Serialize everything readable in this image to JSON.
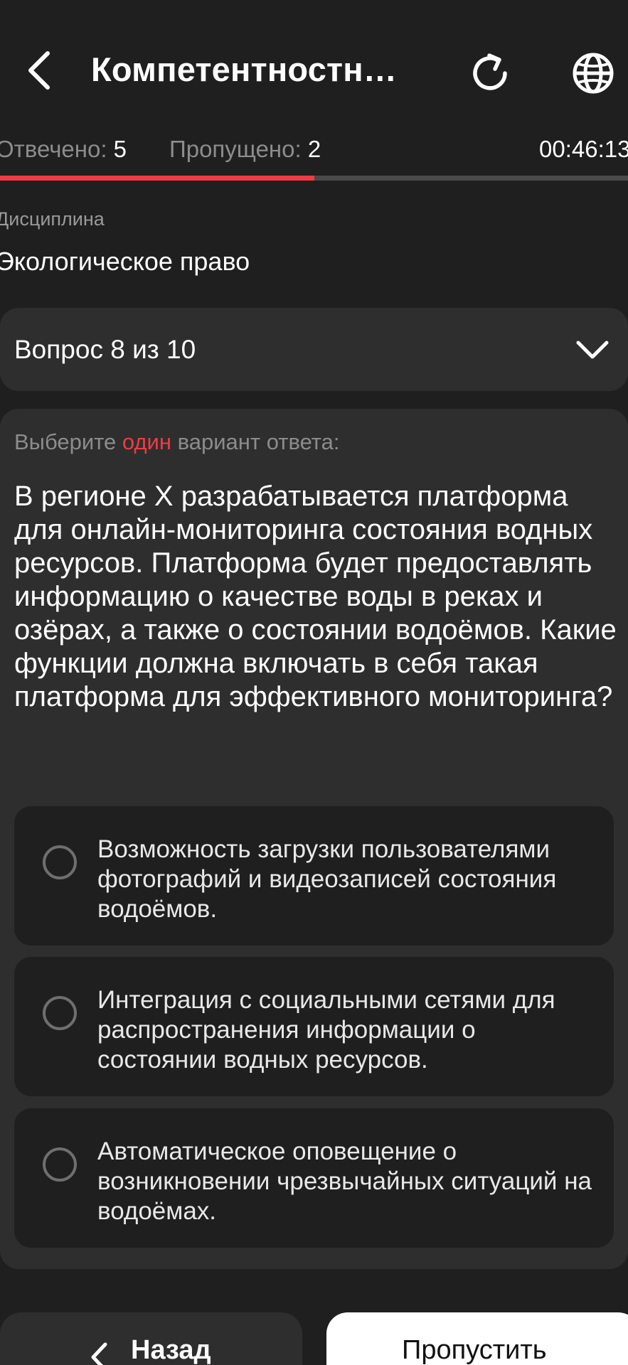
{
  "header": {
    "title": "Компетентностны…"
  },
  "stats": {
    "answered_label": "Отвечено:",
    "answered_value": "5",
    "skipped_label": "Пропущено:",
    "skipped_value": "2",
    "timer": "00:46:13",
    "progress_fraction": 0.5
  },
  "discipline": {
    "label": "Дисциплина",
    "value": "Экологическое право"
  },
  "question_selector": {
    "label": "Вопрос 8 из 10"
  },
  "question": {
    "instruction_prefix": "Выберите",
    "instruction_accent": "один",
    "instruction_suffix": "вариант ответа:",
    "text": "В регионе X разрабатывается платформа для онлайн-мониторинга состояния водных ресурсов. Платформа будет предоставлять информацию о качестве воды в реках и озёрах, а также о состоянии водоёмов. Какие функции должна включать в себя такая платформа для эффективного мониторинга?",
    "options": [
      {
        "text": "Возможность загрузки пользователями фотографий и видеозаписей состояния водоёмов."
      },
      {
        "text": "Интеграция с социальными сетями для распространения информации о состоянии водных ресурсов."
      },
      {
        "text": "Автоматическое оповещение о возникновении чрезвычайных ситуаций на водоёмах."
      }
    ]
  },
  "footer": {
    "back_label": "Назад",
    "skip_label": "Пропустить"
  },
  "colors": {
    "background": "#1f1f1f",
    "card": "#2e2e2e",
    "accent": "#ef3b45",
    "muted": "#8c8c8c"
  },
  "icons": {
    "back": "chevron-left-icon",
    "refresh": "refresh-icon",
    "language": "globe-icon",
    "expand": "chevron-down-icon",
    "radio": "radio-unchecked-icon"
  }
}
